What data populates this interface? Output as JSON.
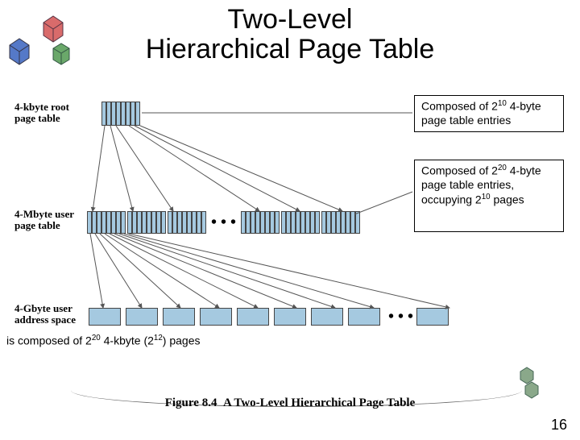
{
  "title_line1": "Two-Level",
  "title_line2": "Hierarchical Page Table",
  "labels": {
    "root": "4-kbyte root\npage table",
    "user": "4-Mbyte user\npage table",
    "addr": "4-Gbyte user\naddress space"
  },
  "notes": {
    "root": {
      "prefix": "Composed of 2",
      "exp1": "10",
      "suffix": " 4-byte page table entries"
    },
    "user": {
      "prefix": "Composed of 2",
      "exp1": "20",
      "mid": " 4-byte page table entries, occupying 2",
      "exp2": "10",
      "suffix": " pages"
    },
    "bottom": {
      "prefix": "is composed of 2",
      "exp1": "20",
      "mid": " 4-kbyte (2",
      "exp2": "12",
      "suffix": ") pages"
    }
  },
  "caption_prefix": "Figure 8.4",
  "caption_rest": "A Two-Level Hierarchical Page Table",
  "pagenum": "16",
  "ellipsis": "• • •",
  "chart_data": {
    "type": "table",
    "title": "Two-Level Hierarchical Page Table",
    "levels": [
      {
        "name": "4-kbyte root page table",
        "entries": 1024,
        "entry_size_bytes": 4,
        "note": "2^10 4-byte page table entries"
      },
      {
        "name": "4-Mbyte user page table",
        "entries": 1048576,
        "entry_size_bytes": 4,
        "pages_occupied": 1024,
        "note": "2^20 4-byte page table entries, occupying 2^10 pages"
      },
      {
        "name": "4-Gbyte user address space",
        "pages": 1048576,
        "page_size_bytes": 4096,
        "note": "2^20 4-kbyte (2^12) pages"
      }
    ]
  }
}
